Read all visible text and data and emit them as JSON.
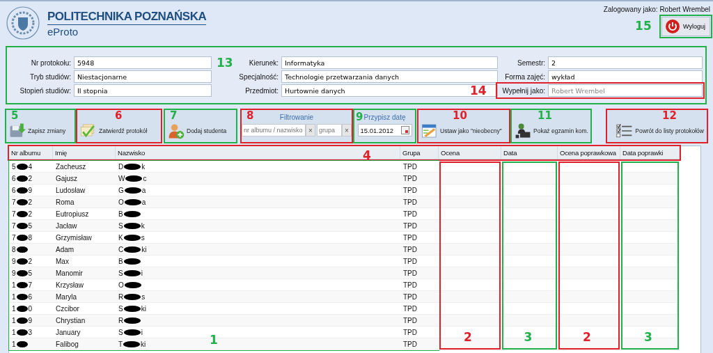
{
  "header": {
    "university": "POLITECHNIKA POZNAŃSKA",
    "app": "eProto",
    "logged_in": "Zalogowany jako: Robert Wrembel",
    "logout": {
      "label": "Wyloguj",
      "annotation": {
        "number": "15",
        "color": "#22b04a"
      }
    }
  },
  "form": {
    "annotation": {
      "number": "13",
      "color": "#22b04a"
    },
    "groups": [
      [
        {
          "label": "Nr protokołu:",
          "value": "5948"
        },
        {
          "label": "Tryb studiów:",
          "value": "Niestacjonarne"
        },
        {
          "label": "Stopień studiów:",
          "value": "II stopnia"
        }
      ],
      [
        {
          "label": "Kierunek:",
          "value": "Informatyka"
        },
        {
          "label": "Specjalność:",
          "value": "Technologie przetwarzania danych"
        },
        {
          "label": "Przedmiot:",
          "value": "Hurtownie danych"
        }
      ],
      [
        {
          "label": "Semestr:",
          "value": "2"
        },
        {
          "label": "Forma zajęć:",
          "value": "wykład"
        },
        {
          "label": "Wypełnij jako:",
          "placeholder": "Robert Wrembel",
          "annotation": {
            "number": "14",
            "color": "#e0202a"
          }
        }
      ]
    ]
  },
  "toolbar": {
    "items": [
      {
        "kind": "button",
        "label": "Zapisz zmiany",
        "annotation": {
          "number": "5",
          "color": "#22b04a"
        }
      },
      {
        "kind": "button",
        "label": "Zatwierdź protokół",
        "annotation": {
          "number": "6",
          "color": "#e0202a"
        }
      },
      {
        "kind": "button",
        "label": "Dodaj studenta",
        "annotation": {
          "number": "7",
          "color": "#22b04a"
        }
      },
      {
        "kind": "filter",
        "title": "Filtrowanie",
        "fields": [
          {
            "placeholder": "nr albumu / nazwisko",
            "clear": "×"
          },
          {
            "placeholder": "grupa",
            "clear": "×"
          }
        ],
        "annotation": {
          "number": "8",
          "color": "#e0202a"
        }
      },
      {
        "kind": "date",
        "title": "Przypisz datę",
        "value": "15.01.2012",
        "annotation": {
          "number": "9",
          "color": "#22b04a"
        }
      },
      {
        "kind": "button",
        "label": "Ustaw jako \"nieobecny\"",
        "annotation": {
          "number": "10",
          "color": "#e0202a"
        }
      },
      {
        "kind": "button",
        "label": "Pokaż egzamin kom.",
        "annotation": {
          "number": "11",
          "color": "#22b04a"
        }
      },
      {
        "kind": "button",
        "label": "Powrót do listy protokołów",
        "annotation": {
          "number": "12",
          "color": "#e0202a"
        }
      }
    ]
  },
  "table": {
    "header_annotation": {
      "number": "4",
      "color": "#e0202a"
    },
    "main_annotation": {
      "number": "1",
      "color": "#22b04a"
    },
    "columns": [
      {
        "label": "Nr albumu"
      },
      {
        "label": "Imię"
      },
      {
        "label": "Nazwisko"
      },
      {
        "label": "Grupa"
      },
      {
        "label": "Ocena",
        "annotation": {
          "number": "2",
          "color": "#e0202a"
        }
      },
      {
        "label": "Data",
        "annotation": {
          "number": "3",
          "color": "#22b04a"
        }
      },
      {
        "label": "Ocena poprawkowa",
        "annotation": {
          "number": "2",
          "color": "#e0202a"
        }
      },
      {
        "label": "Data poprawki",
        "annotation": {
          "number": "3",
          "color": "#22b04a"
        }
      }
    ],
    "rows": [
      {
        "album": {
          "start": "5",
          "end": "4"
        },
        "first_name": "Zacheusz",
        "surname": {
          "start": "D",
          "end": "k"
        },
        "group": "TPD"
      },
      {
        "album": {
          "start": "6",
          "end": "2"
        },
        "first_name": "Gajusz",
        "surname": {
          "start": "W",
          "end": "c"
        },
        "group": "TPD"
      },
      {
        "album": {
          "start": "6",
          "end": "9"
        },
        "first_name": "Ludosław",
        "surname": {
          "start": "G",
          "end": "a"
        },
        "group": "TPD"
      },
      {
        "album": {
          "start": "7",
          "end": "2"
        },
        "first_name": "Roma",
        "surname": {
          "start": "O",
          "end": "a"
        },
        "group": "TPD"
      },
      {
        "album": {
          "start": "7",
          "end": "2"
        },
        "first_name": "Eutropiusz",
        "surname": {
          "start": "B"
        },
        "group": "TPD"
      },
      {
        "album": {
          "start": "7",
          "end": "5"
        },
        "first_name": "Jacław",
        "surname": {
          "start": "S",
          "end": "k"
        },
        "group": "TPD"
      },
      {
        "album": {
          "start": "7",
          "end": "8"
        },
        "first_name": "Grzymisław",
        "surname": {
          "start": "K",
          "end": "s"
        },
        "group": "TPD"
      },
      {
        "album": {
          "start": "8"
        },
        "first_name": "Adam",
        "surname": {
          "start": "C",
          "end": "ki"
        },
        "group": "TPD"
      },
      {
        "album": {
          "start": "9",
          "end": "2"
        },
        "first_name": "Max",
        "surname": {
          "start": "B"
        },
        "group": "TPD"
      },
      {
        "album": {
          "start": "9",
          "end": "5"
        },
        "first_name": "Manomir",
        "surname": {
          "start": "S",
          "end": "i"
        },
        "group": "TPD"
      },
      {
        "album": {
          "start": "1",
          "end": "7"
        },
        "first_name": "Krzysław",
        "surname": {
          "start": "O"
        },
        "group": "TPD"
      },
      {
        "album": {
          "start": "1",
          "end": "6"
        },
        "first_name": "Maryla",
        "surname": {
          "start": "R",
          "end": "s"
        },
        "group": "TPD"
      },
      {
        "album": {
          "start": "1",
          "end": "0"
        },
        "first_name": "Czcibor",
        "surname": {
          "start": "S",
          "end": "ki"
        },
        "group": "TPD"
      },
      {
        "album": {
          "start": "1",
          "end": "9"
        },
        "first_name": "Chrystian",
        "surname": {
          "start": "R"
        },
        "group": "TPD"
      },
      {
        "album": {
          "start": "1",
          "end": "3"
        },
        "first_name": "January",
        "surname": {
          "start": "S",
          "end": "i"
        },
        "group": "TPD"
      },
      {
        "album": {
          "start": "1"
        },
        "first_name": "Falibog",
        "surname": {
          "start": "T",
          "end": "ki"
        },
        "group": "TPD"
      }
    ]
  }
}
